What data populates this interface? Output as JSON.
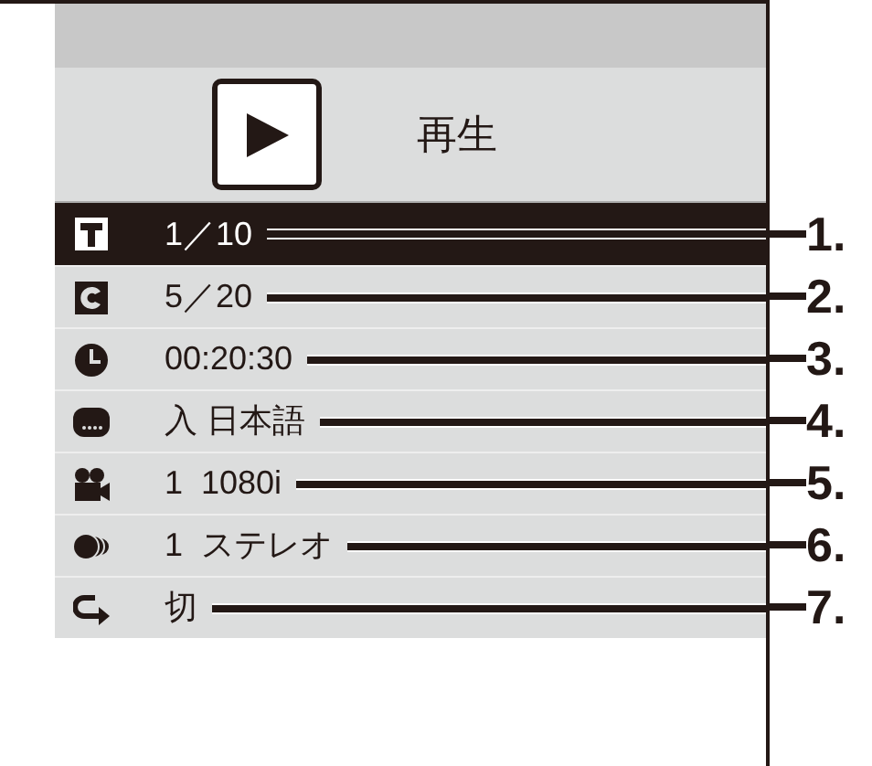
{
  "header": {
    "mode_label": "再生"
  },
  "rows": [
    {
      "kind": "title",
      "value": "1／10",
      "selected": true,
      "callout": "1."
    },
    {
      "kind": "chapter",
      "value": "5／20",
      "selected": false,
      "callout": "2."
    },
    {
      "kind": "time",
      "value": "00:20:30",
      "selected": false,
      "callout": "3."
    },
    {
      "kind": "subtitle",
      "value": "入 日本語",
      "selected": false,
      "callout": "4."
    },
    {
      "kind": "video",
      "value": "1  1080i",
      "selected": false,
      "callout": "5."
    },
    {
      "kind": "audio",
      "value": "1  ステレオ",
      "selected": false,
      "callout": "6."
    },
    {
      "kind": "repeat",
      "value": "切",
      "selected": false,
      "callout": "7."
    }
  ]
}
